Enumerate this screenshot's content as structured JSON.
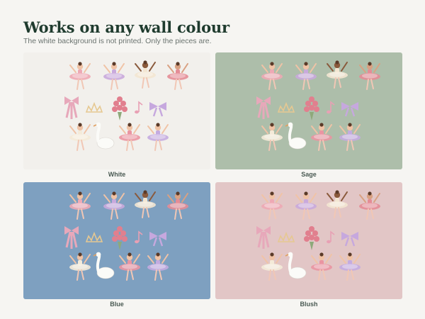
{
  "header": {
    "title": "Works on any wall colour",
    "subtitle": "The white background is not printed. Only the pieces are."
  },
  "panels": [
    {
      "label": "White",
      "background": "#f2f0ec"
    },
    {
      "label": "Sage",
      "background": "#adbeaa"
    },
    {
      "label": "Blue",
      "background": "#7ea0c0"
    },
    {
      "label": "Blush",
      "background": "#e2c6c6"
    }
  ],
  "pieces": [
    {
      "name": "ballerina-pink",
      "tutu": "#eea9b4"
    },
    {
      "name": "ballerina-lilac",
      "tutu": "#c9a9dc"
    },
    {
      "name": "ballerina-cream",
      "tutu": "#f3e6d2"
    },
    {
      "name": "ballerina-rose",
      "tutu": "#e48c96"
    },
    {
      "name": "bow-ribbon-icon",
      "tutu": "#e7a8ba"
    },
    {
      "name": "tiara-icon",
      "tutu": "#e6c891"
    },
    {
      "name": "rose-bouquet-icon",
      "tutu": "#e17f8e"
    },
    {
      "name": "music-note-icon",
      "tutu": "#e8a0b4"
    },
    {
      "name": "lilac-bow-icon",
      "tutu": "#c6a8de"
    },
    {
      "name": "ballerina-cream-2",
      "tutu": "#f4ead8"
    },
    {
      "name": "swan-icon",
      "tutu": "#ffffff"
    },
    {
      "name": "ballerina-rose-2",
      "tutu": "#ea95a2"
    },
    {
      "name": "ballerina-lilac-2",
      "tutu": "#c4abe0"
    }
  ]
}
